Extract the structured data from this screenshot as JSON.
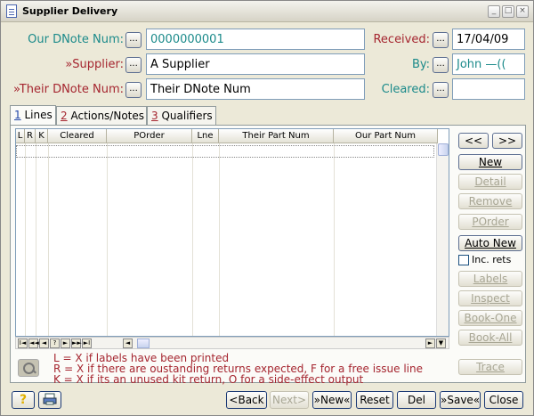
{
  "window": {
    "title": "Supplier Delivery",
    "controls": [
      "_",
      "□",
      "×"
    ]
  },
  "form": {
    "our_dnote": {
      "label": "Our DNote Num:",
      "value": "0000000001"
    },
    "supplier": {
      "label": "»Supplier:",
      "value": "A Supplier"
    },
    "their_dnote": {
      "label": "»Their DNote Num:",
      "value": "Their DNote Num"
    },
    "received": {
      "label": "Received:",
      "value": "17/04/09"
    },
    "by": {
      "label": "By:",
      "value": "John     —(("
    },
    "cleared": {
      "label": "Cleared:",
      "value": ""
    },
    "lookup_label": "..."
  },
  "tabs": [
    {
      "key": "1",
      "label": "Lines"
    },
    {
      "key": "2",
      "label": "Actions/Notes"
    },
    {
      "key": "3",
      "label": "Qualifiers"
    }
  ],
  "grid": {
    "columns": [
      "L",
      "R",
      "K",
      "Cleared",
      "POrder",
      "Lne",
      "Their Part Num",
      "Our Part Num"
    ],
    "nav_buttons": [
      "I◄",
      "◄◄",
      "◄",
      "?",
      "►",
      "►►",
      "►I"
    ]
  },
  "side_buttons": {
    "prev": "<<",
    "next": ">>",
    "new": "New",
    "detail": "Detail",
    "remove": "Remove",
    "porder": "POrder",
    "auto_new": "Auto New",
    "inc_rets": "Inc. rets",
    "labels": "Labels",
    "inspect": "Inspect",
    "book_one": "Book-One",
    "book_all": "Book-All",
    "trace": "Trace"
  },
  "legend": [
    "L = X if labels have been printed",
    "R = X if there are oustanding returns expected, F for a free issue line",
    "K = X if its an unused kit return, O for a side-effect output"
  ],
  "bottom_buttons": {
    "back": "<Back",
    "next": "Next>",
    "new": "»New«",
    "reset": "Reset",
    "del": "Del",
    "save": "»Save«",
    "close": "Close"
  },
  "colors": {
    "teal_label": "#1b8a8a",
    "required_label": "#a5252f",
    "window_bg": "#ece9d8"
  }
}
